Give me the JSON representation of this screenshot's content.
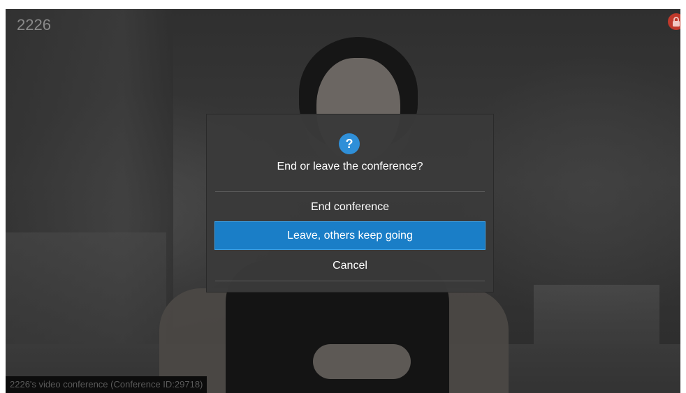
{
  "call": {
    "caller_number": "2226",
    "status_text": "2226's video conference (Conference ID:29718)"
  },
  "dialog": {
    "icon": "question-icon",
    "icon_glyph": "?",
    "title": "End or leave the conference?",
    "options": [
      {
        "label": "End conference",
        "selected": false
      },
      {
        "label": "Leave, others keep going",
        "selected": true
      },
      {
        "label": "Cancel",
        "selected": false
      }
    ]
  },
  "colors": {
    "accent": "#1a7ec7",
    "question_icon": "#2f8fd8",
    "lock_badge": "#c0392b"
  },
  "indicators": {
    "lock_icon": "lock-icon"
  }
}
